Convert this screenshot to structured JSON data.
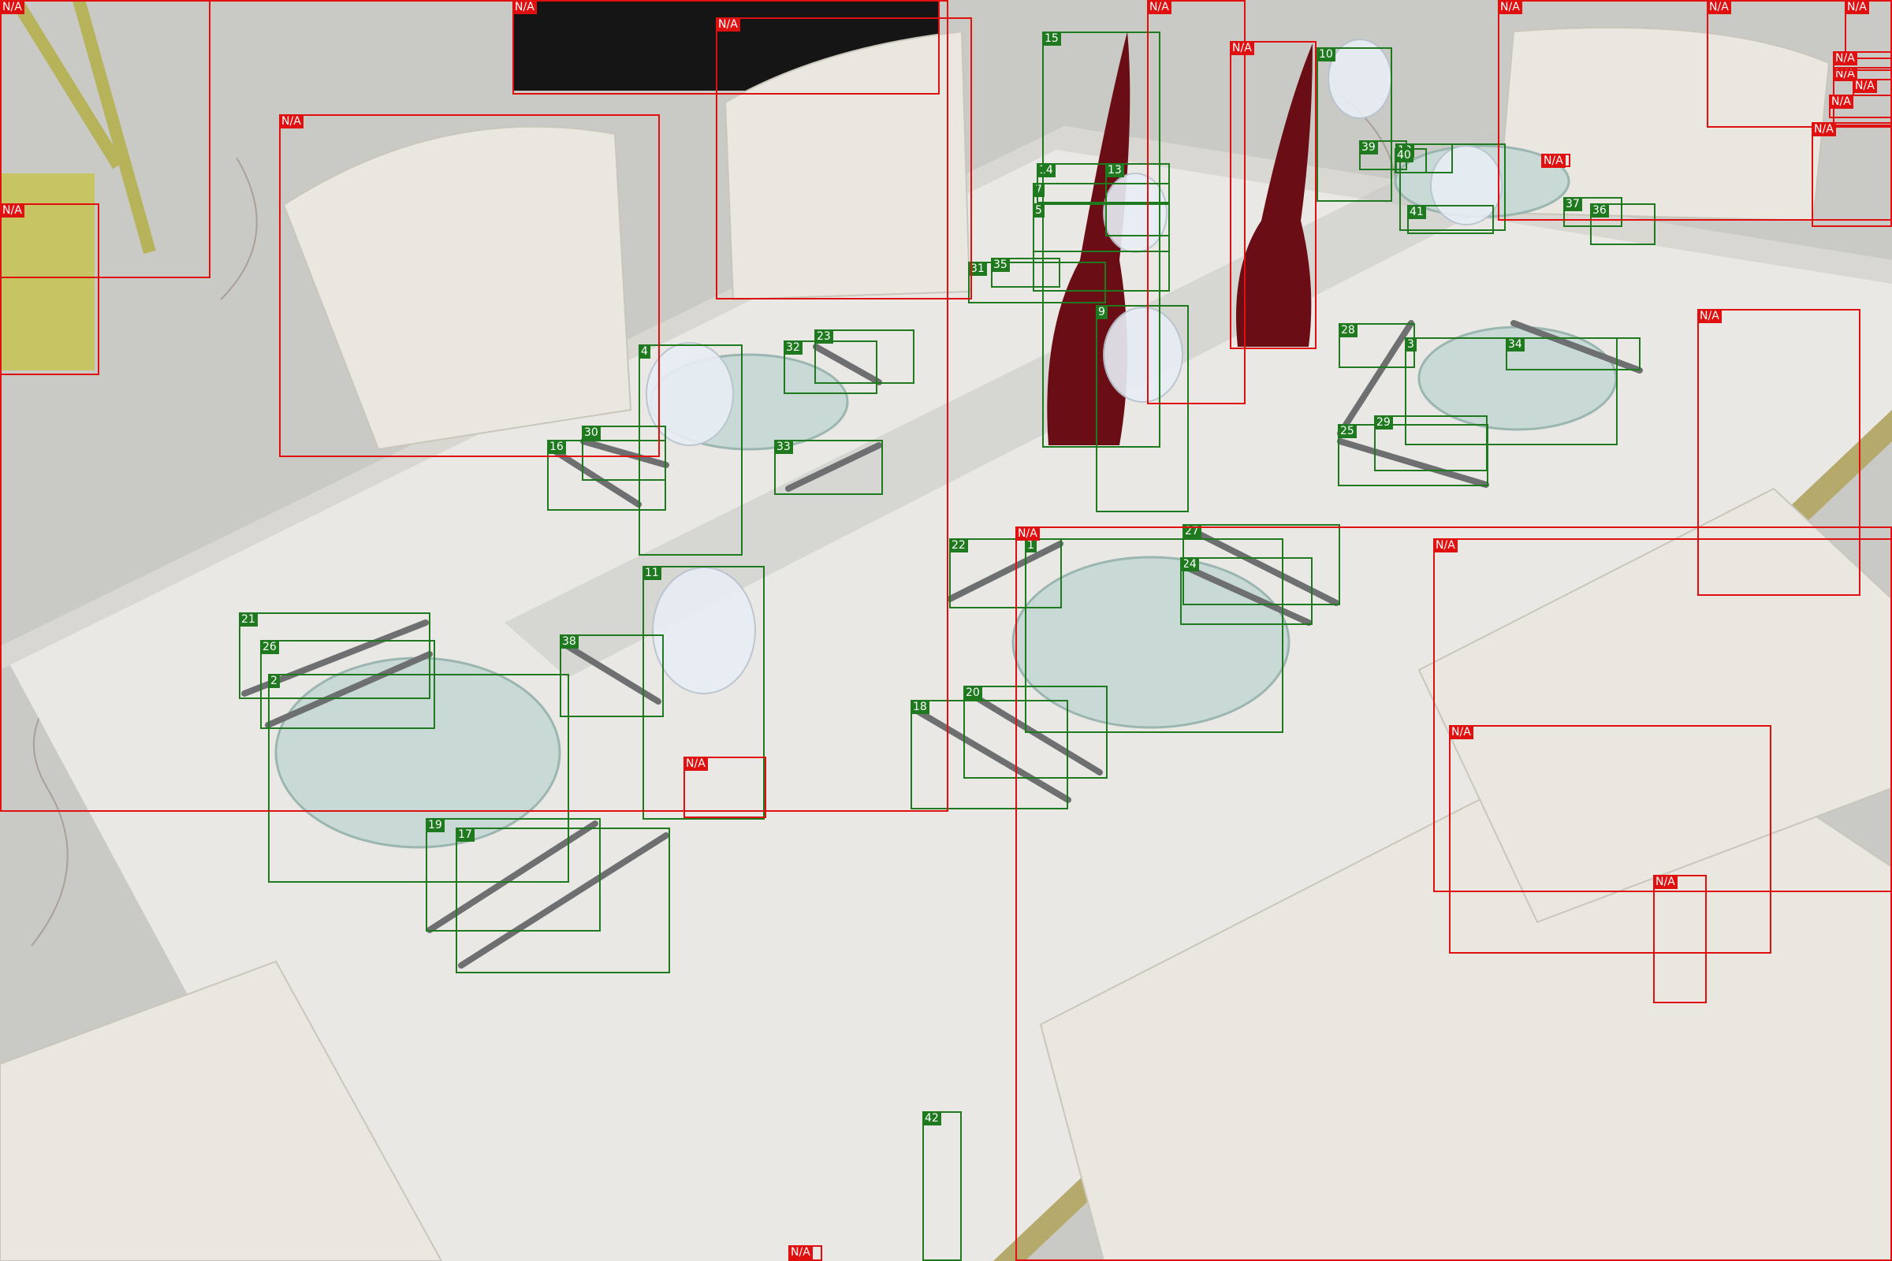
{
  "colors": {
    "detected": "#1f7a1f",
    "unlabeled": "#e01010"
  },
  "annotations": {
    "detected_labels": [
      "1",
      "2",
      "3",
      "4",
      "5",
      "6",
      "7",
      "9",
      "10",
      "11",
      "12",
      "13",
      "14",
      "15",
      "16",
      "17",
      "18",
      "19",
      "20",
      "21",
      "22",
      "23",
      "24",
      "25",
      "26",
      "27",
      "28",
      "29",
      "30",
      "31",
      "32",
      "33",
      "34",
      "35",
      "36",
      "37",
      "38",
      "39",
      "40",
      "41",
      "42"
    ],
    "unlabeled_label": "N/A",
    "unlabeled_count": 24
  }
}
